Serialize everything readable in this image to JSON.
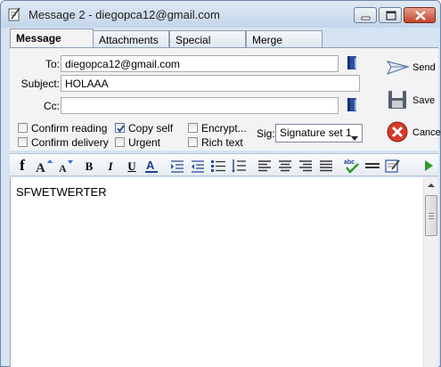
{
  "window": {
    "title": "Message 2 - diegopca12@gmail.com",
    "icon": "message-edit-icon"
  },
  "tabs": [
    {
      "label": "Message",
      "active": true
    },
    {
      "label": "Attachments",
      "active": false
    },
    {
      "label": "Special",
      "active": false
    },
    {
      "label": "Merge",
      "active": false
    }
  ],
  "fields": {
    "to_label": "To:",
    "to_value": "diegopca12@gmail.com",
    "subject_label": "Subject:",
    "subject_value": "HOLAAA",
    "cc_label": "Cc:",
    "cc_value": ""
  },
  "actions": {
    "send_label": "Send",
    "save_label": "Save",
    "cancel_label": "Cancel"
  },
  "options": [
    {
      "label": "Confirm reading",
      "checked": false
    },
    {
      "label": "Confirm delivery",
      "checked": false
    },
    {
      "label": "Copy self",
      "checked": true
    },
    {
      "label": "Urgent",
      "checked": false
    },
    {
      "label": "Encrypt...",
      "checked": false
    },
    {
      "label": "Rich text",
      "checked": false
    }
  ],
  "signature": {
    "label": "Sig:",
    "selected": "Signature set 1"
  },
  "toolbar_icons": [
    "font-icon",
    "font-grow-icon",
    "font-shrink-icon",
    "bold-icon",
    "italic-icon",
    "underline-icon",
    "font-color-icon",
    "indent-icon",
    "outdent-icon",
    "bullet-list-icon",
    "numbered-list-icon",
    "align-left-icon",
    "align-center-icon",
    "align-right-icon",
    "justify-icon",
    "spellcheck-icon",
    "horizontal-line-icon",
    "edit-html-icon",
    "play-icon"
  ],
  "editor": {
    "body_text": "SFWETWERTER"
  },
  "colors": {
    "window_frame": "#6d87a8",
    "title_gradient_top": "#dfe9f5",
    "panel_bg": "#f3f3f3",
    "close_button": "#c4432a",
    "address_book_blue": "#2b4f9e"
  }
}
